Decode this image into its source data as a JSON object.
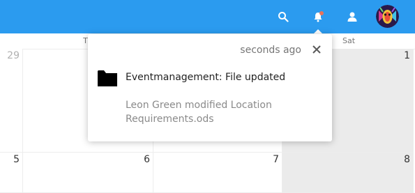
{
  "header": {
    "icons": {
      "search": "search-icon",
      "notifications": "bell-icon",
      "contacts": "contacts-icon",
      "avatar": "user-avatar"
    },
    "colors": {
      "header_bg": "#2b9bef",
      "notification_dot": "#e9735a"
    }
  },
  "calendar": {
    "day_headers": {
      "thu": "Th",
      "sat": "Sat"
    },
    "week1": {
      "mon": "29",
      "sat": "1"
    },
    "week2": {
      "mon": "5",
      "tue": "6",
      "wed": "7",
      "sat": "8"
    }
  },
  "notification": {
    "timestamp": "seconds ago",
    "icon": "folder-icon",
    "subject": "Eventmanagement: File updated",
    "message": "Leon Green modified Location Requirements.ods"
  }
}
